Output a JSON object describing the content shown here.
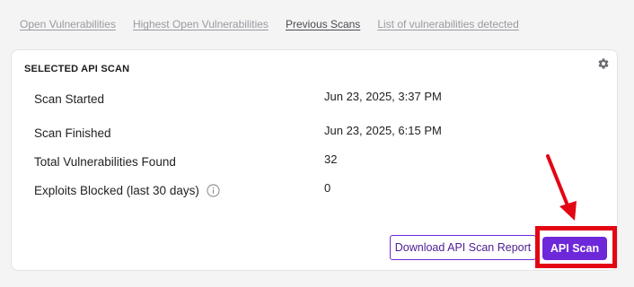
{
  "tabs": [
    {
      "label": "Open Vulnerabilities"
    },
    {
      "label": "Highest Open Vulnerabilities"
    },
    {
      "label": "Previous Scans"
    },
    {
      "label": "List of vulnerabilities detected"
    }
  ],
  "card": {
    "title": "SELECTED API SCAN",
    "settings_icon": "gear-icon",
    "rows": [
      {
        "label": "Scan Started",
        "value": "Jun 23, 2025, 3:37 PM"
      },
      {
        "label": "Scan Finished",
        "value": "Jun 23, 2025, 6:15 PM"
      },
      {
        "label": "Total Vulnerabilities Found",
        "value": "32"
      },
      {
        "label": "Exploits Blocked (last 30 days)",
        "value": "0",
        "icon": "info-icon"
      }
    ],
    "download_button": "Download API Scan Report",
    "scan_button": "API Scan"
  },
  "colors": {
    "accent": "#6d28d9",
    "annotation": "#e30613"
  }
}
